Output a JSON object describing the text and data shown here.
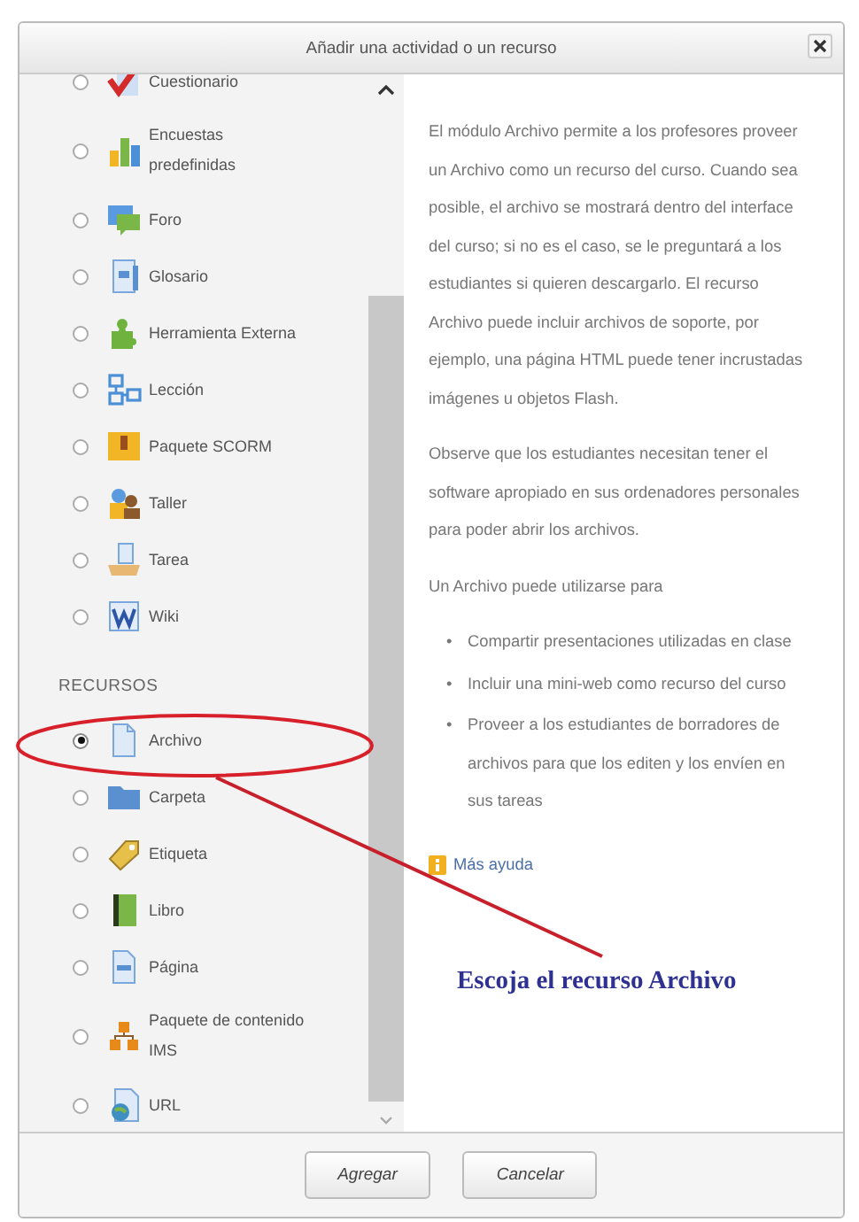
{
  "window": {
    "title": "Añadir una actividad o un recurso"
  },
  "sections": [
    {
      "items": [
        {
          "label": "Cuestionario",
          "selected": false
        },
        {
          "label": "Encuestas predefinidas",
          "selected": false
        },
        {
          "label": "Foro",
          "selected": false
        },
        {
          "label": "Glosario",
          "selected": false
        },
        {
          "label": "Herramienta Externa",
          "selected": false
        },
        {
          "label": "Lección",
          "selected": false
        },
        {
          "label": "Paquete SCORM",
          "selected": false
        },
        {
          "label": "Taller",
          "selected": false
        },
        {
          "label": "Tarea",
          "selected": false
        },
        {
          "label": "Wiki",
          "selected": false
        }
      ]
    },
    {
      "heading": "RECURSOS",
      "items": [
        {
          "label": "Archivo",
          "selected": true
        },
        {
          "label": "Carpeta",
          "selected": false
        },
        {
          "label": "Etiqueta",
          "selected": false
        },
        {
          "label": "Libro",
          "selected": false
        },
        {
          "label": "Página",
          "selected": false
        },
        {
          "label": "Paquete de contenido IMS",
          "selected": false
        },
        {
          "label": "URL",
          "selected": false
        }
      ]
    }
  ],
  "help": {
    "paragraphs": [
      "El módulo Archivo permite a los profesores proveer un Archivo como un recurso del curso. Cuando sea posible, el archivo se mostrará dentro del interface del curso; si no es el caso, se le preguntará a los estudiantes si quieren descargarlo. El recurso Archivo puede incluir archivos de soporte, por ejemplo, una página HTML puede tener incrustadas imágenes u objetos Flash.",
      "Observe que los estudiantes necesitan tener el software apropiado en sus ordenadores personales para poder abrir los archivos.",
      "Un Archivo puede utilizarse para"
    ],
    "bullets": [
      {
        "marker": "•",
        "text": "Compartir presentaciones utilizadas en clase"
      },
      {
        "marker": "•",
        "text": "Incluir una mini-web como recurso del curso"
      },
      {
        "marker": "•",
        "text": "Proveer a los estudiantes de borradores de archivos para que los editen y los envíen en sus tareas"
      }
    ],
    "more_link": "Más ayuda"
  },
  "buttons": [
    "Agregar",
    "Cancelar"
  ],
  "annotation": {
    "text": "Escoja el recurso Archivo"
  }
}
